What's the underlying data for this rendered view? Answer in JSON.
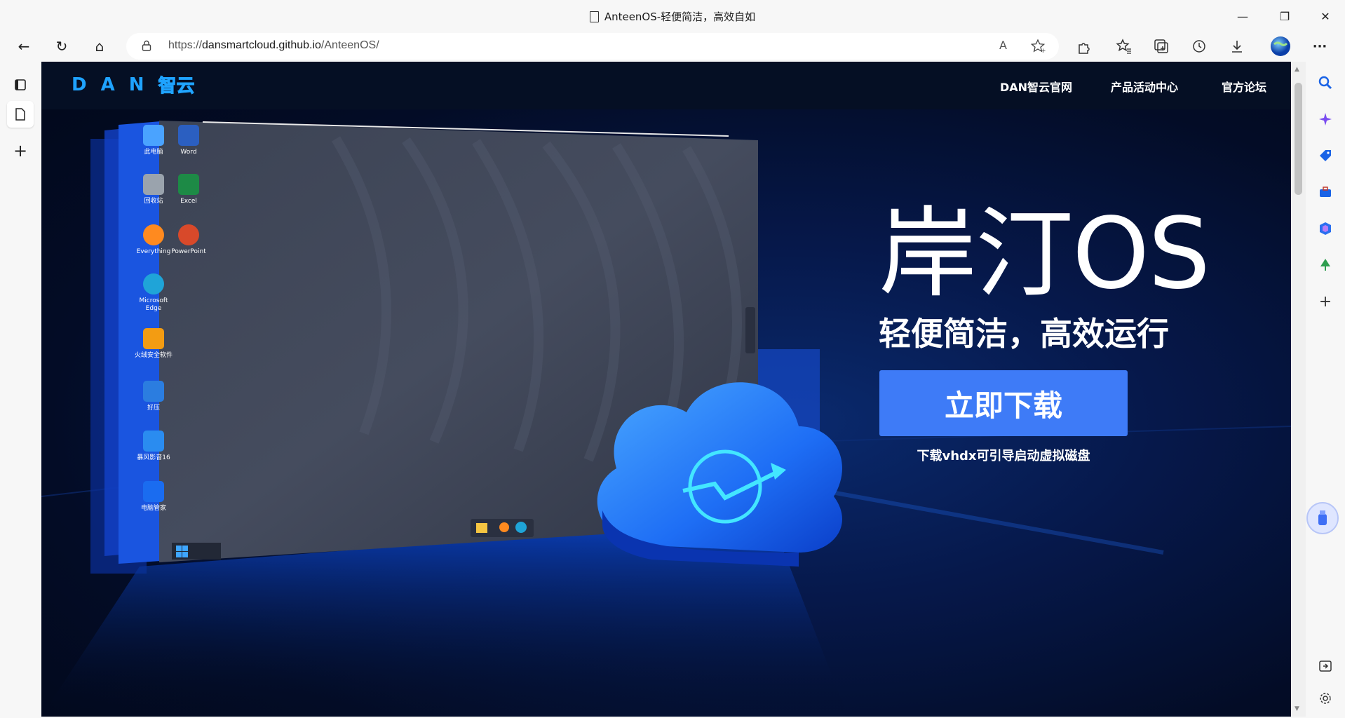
{
  "window": {
    "title": "AnteenOS-轻便简洁，高效自如",
    "minimize": "—",
    "restore": "❐",
    "close": "✕"
  },
  "toolbar": {
    "back": "←",
    "reload": "↻",
    "home": "⌂",
    "url_prefix": "https://",
    "url_host": "dansmartcloud.github.io",
    "url_path": "/AnteenOS/",
    "read_aloud": "A",
    "more": "···"
  },
  "site": {
    "logo_letters": [
      "D",
      "A",
      "N"
    ],
    "logo_cn": "智云",
    "nav": [
      "DAN智云官网",
      "产品活动中心",
      "官方论坛"
    ],
    "hero_title": "岸汀OS",
    "hero_subtitle": "轻便简洁，高效运行",
    "download_button": "立即下载",
    "download_note": "下载vhdx可引导启动虚拟磁盘"
  },
  "desktop_icons": [
    {
      "label": "此电脑",
      "color": "#4aa3ff"
    },
    {
      "label": "Word",
      "color": "#2b5fc1"
    },
    {
      "label": "回收站",
      "color": "#9aa3ad"
    },
    {
      "label": "Excel",
      "color": "#1d8a46"
    },
    {
      "label": "Everything",
      "color": "#ff8a1f"
    },
    {
      "label": "PowerPoint",
      "color": "#d8492a"
    },
    {
      "label": "Microsoft Edge",
      "color": "#1fa4d8"
    },
    {
      "label": "火绒安全软件",
      "color": "#f39c12"
    },
    {
      "label": "好压",
      "color": "#2b7de0"
    },
    {
      "label": "暴风影音16",
      "color": "#2a8cf0"
    },
    {
      "label": "电脑管家",
      "color": "#1a6cf0"
    }
  ],
  "colors": {
    "accent_blue": "#3e7bf7",
    "nav_bg": "#050f24",
    "logo_blue": "#1fa3ff"
  }
}
